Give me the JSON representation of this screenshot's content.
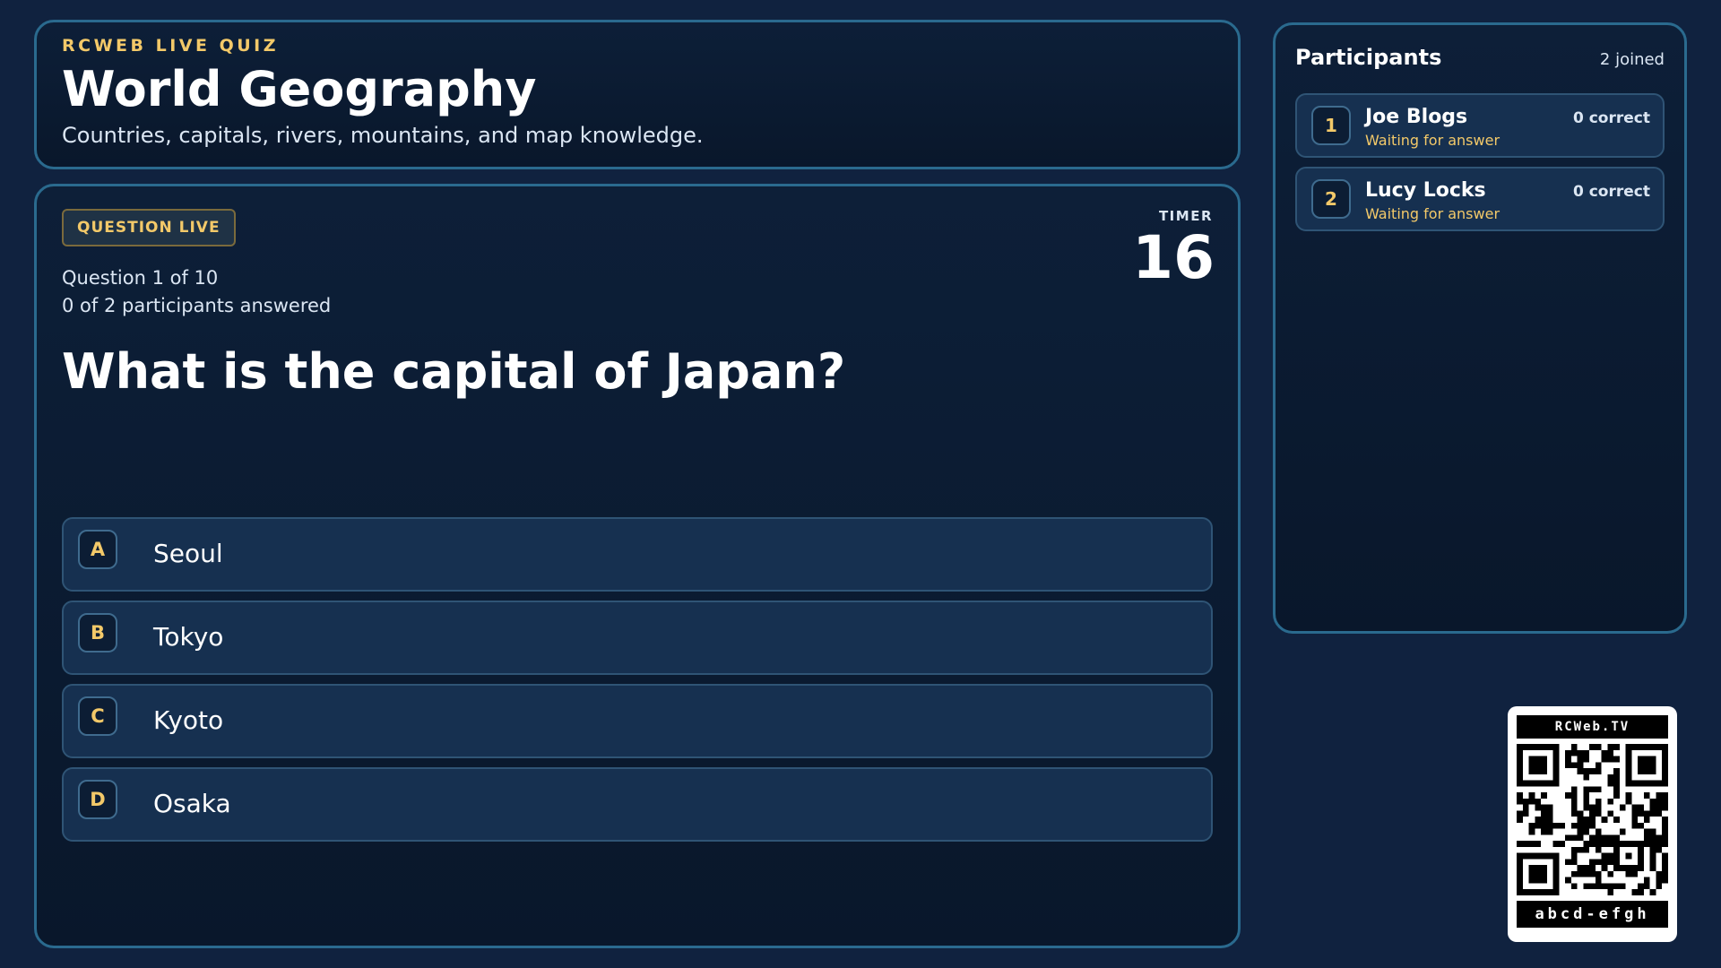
{
  "header": {
    "kicker": "RCWEB LIVE QUIZ",
    "title": "World Geography",
    "subtitle": "Countries, capitals, rivers, mountains, and map knowledge."
  },
  "question": {
    "badge": "QUESTION LIVE",
    "timer_label": "TIMER",
    "timer_value": "16",
    "progress_text": "Question 1 of 10",
    "answered_text": "0 of 2 participants answered",
    "text": "What is the capital of Japan?",
    "options": [
      {
        "letter": "A",
        "text": "Seoul"
      },
      {
        "letter": "B",
        "text": "Tokyo"
      },
      {
        "letter": "C",
        "text": "Kyoto"
      },
      {
        "letter": "D",
        "text": "Osaka"
      }
    ]
  },
  "participants": {
    "title": "Participants",
    "count_text": "2 joined",
    "list": [
      {
        "rank": "1",
        "name": "Joe Blogs",
        "status": "Waiting for answer",
        "score": "0 correct"
      },
      {
        "rank": "2",
        "name": "Lucy Locks",
        "status": "Waiting for answer",
        "score": "0 correct"
      }
    ]
  },
  "qr": {
    "brand": "RCWeb.TV",
    "code": "abcd-efgh"
  },
  "colors": {
    "background": "#10223f",
    "accent": "#f3c969",
    "panel_border": "#2a6a8e",
    "option_bg": "#163050"
  }
}
